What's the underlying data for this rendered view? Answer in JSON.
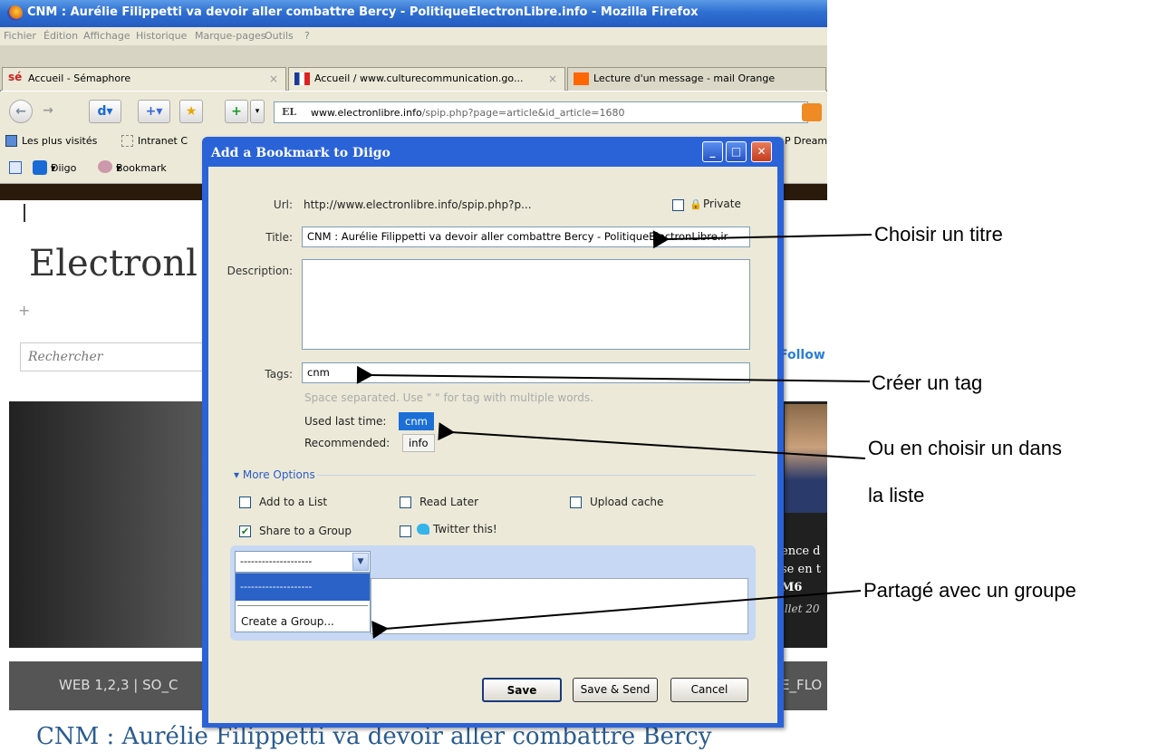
{
  "window": {
    "title": "CNM : Aurélie Filippetti va devoir aller combattre Bercy - PolitiqueElectronLibre.info - Mozilla Firefox"
  },
  "menu": {
    "items": [
      "Fichier",
      "Édition",
      "Affichage",
      "Historique",
      "Marque-pages",
      "Outils",
      "?"
    ]
  },
  "tabs": [
    {
      "label": "Accueil - Sémaphore",
      "close": "×"
    },
    {
      "label": "Accueil / www.culturecommunication.go...",
      "close": "×"
    },
    {
      "label": "Lecture d'un message - mail Orange"
    }
  ],
  "nav": {
    "url_domain": "www.electronlibre.info",
    "url_path": "/spip.php?page=article&id_article=1680",
    "el": "EL"
  },
  "bookmarks": {
    "row1": [
      "Les plus visités",
      "Intranet C",
      "P Dream"
    ],
    "row2": [
      "Diigo",
      "Bookmark"
    ]
  },
  "page": {
    "site_title": "Electronl",
    "plus": "+",
    "search_placeholder": "Rechercher",
    "follow": "Follow",
    "photo_text": [
      "ence d",
      "se en t",
      "M6",
      "illet 20"
    ],
    "nav_text": "WEB 1,2,3  |  SO_C",
    "nav_text_right": "E_FLO",
    "article_title": "CNM : Aurélie Filippetti va devoir aller combattre Bercy"
  },
  "dialog": {
    "title": "Add a Bookmark to Diigo",
    "url_label": "Url:",
    "url_value": "http://www.electronlibre.info/spip.php?p...",
    "private_label": "Private",
    "title_label": "Title:",
    "title_value": "CNM : Aurélie Filippetti va devoir aller combattre Bercy - PolitiqueElectronLibre.ir",
    "description_label": "Description:",
    "description_value": "",
    "tags_label": "Tags:",
    "tags_value": "cnm",
    "tags_hint": "Space separated. Use \" \" for tag with multiple words.",
    "used_last_label": "Used last time:",
    "used_last_tag": "cnm",
    "recommended_label": "Recommended:",
    "recommended_tag": "info",
    "more_options": "More Options",
    "options": {
      "add_list": "Add to a List",
      "read_later": "Read Later",
      "upload_cache": "Upload cache",
      "share_group": "Share to a Group",
      "twitter": "Twitter this!"
    },
    "group_select": "--------------------",
    "group_options": [
      "--------------------",
      "Create a Group..."
    ],
    "buttons": {
      "save": "Save",
      "save_send": "Save & Send",
      "cancel": "Cancel"
    }
  },
  "annotations": {
    "title": "Choisir un titre",
    "tag": "Créer un tag",
    "choose_1": "Ou en choisir un dans",
    "choose_2": "la liste",
    "share": "Partagé avec un groupe"
  }
}
